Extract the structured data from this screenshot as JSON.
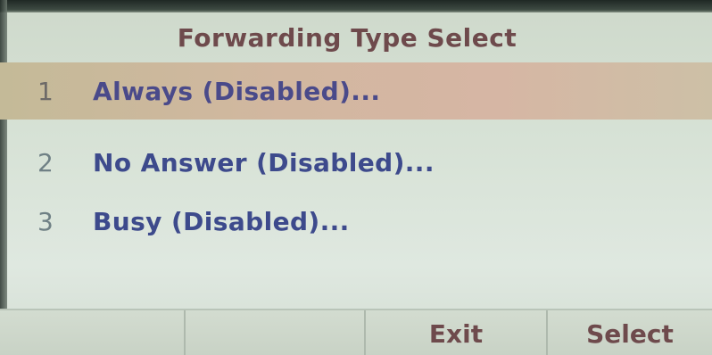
{
  "screen": {
    "title": "Forwarding Type Select",
    "selected_index": 0,
    "menu_items": [
      {
        "number": "1",
        "label": "Always (Disabled)..."
      },
      {
        "number": "2",
        "label": "No Answer (Disabled)..."
      },
      {
        "number": "3",
        "label": "Busy (Disabled)..."
      }
    ],
    "softkeys": [
      "",
      "",
      "Exit",
      "Select"
    ]
  },
  "colors": {
    "title": "#6e4a4c",
    "item_label": "#3d4a8c",
    "highlight": "#d2b7a0",
    "background": "#d7e2d6"
  }
}
